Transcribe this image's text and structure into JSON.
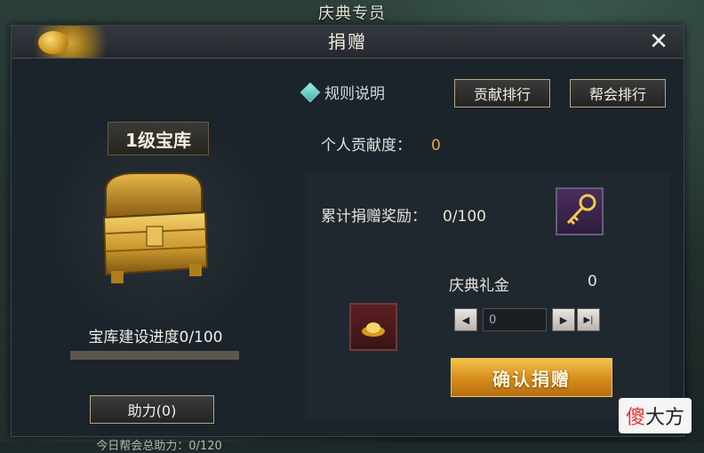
{
  "top_banner": {
    "text": "庆典专员"
  },
  "dialog": {
    "title": "捐赠",
    "close_symbol": "✕",
    "rules_link": "规则说明",
    "rank_buttons": {
      "contribution": "贡献排行",
      "guild": "帮会排行"
    },
    "personal": {
      "label": "个人贡献度：",
      "value": "0"
    },
    "cumulative": {
      "label": "累计捐赠奖励：",
      "value": "0/100"
    },
    "gift": {
      "label": "庆典礼金",
      "count": "0"
    },
    "stepper": {
      "prev_symbol": "◀",
      "next_symbol": "▶",
      "max_symbol": "▶|",
      "input_value": "0"
    },
    "confirm_label": "确认捐赠"
  },
  "treasury": {
    "level_label": "1级宝库",
    "progress_label": "宝库建设进度0/100",
    "progress_fraction": 0.0,
    "assist_button": "助力(0)",
    "assist_total": "今日帮会总助力：0/120"
  },
  "watermark": {
    "part1": "傻",
    "part2": "大方"
  },
  "colors": {
    "accent_orange": "#e9a640",
    "button_gold": "#d58b1c",
    "panel_bg": "#1b232b",
    "progress_fill": "#c79a3a"
  },
  "icons": {
    "rules": "diamond-icon",
    "reward_item": "golden-key-icon",
    "gift_item": "gold-ingot-icon",
    "chest": "treasure-chest-icon",
    "close": "close-icon"
  }
}
